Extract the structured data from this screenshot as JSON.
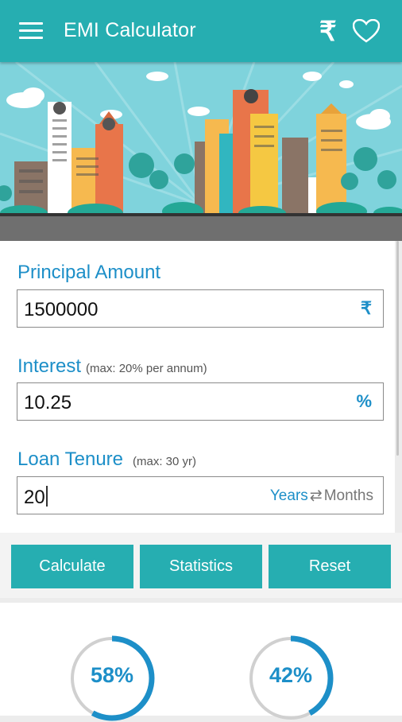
{
  "appbar": {
    "title": "EMI Calculator",
    "rupee_icon": "rupee-icon",
    "favorite_icon": "heart-icon",
    "color": "#26aeb1"
  },
  "form": {
    "principal": {
      "label": "Principal Amount",
      "value": "1500000",
      "unit": "₹"
    },
    "interest": {
      "label": "Interest",
      "hint": "(max: 20% per annum)",
      "value": "10.25",
      "unit": "%"
    },
    "tenure": {
      "label": "Loan Tenure",
      "hint": "(max: 30 yr)",
      "value": "20",
      "unit_selected": "Years",
      "unit_other": "Months",
      "swap_icon": "swap-arrows-icon"
    }
  },
  "buttons": {
    "calculate": "Calculate",
    "statistics": "Statistics",
    "reset": "Reset"
  },
  "stats": {
    "principal_share": {
      "label": "58%",
      "fraction": 0.58
    },
    "interest_share": {
      "label": "42%",
      "fraction": 0.42
    }
  },
  "colors": {
    "accent_blue": "#1d8fc8",
    "teal": "#26aeb1"
  }
}
